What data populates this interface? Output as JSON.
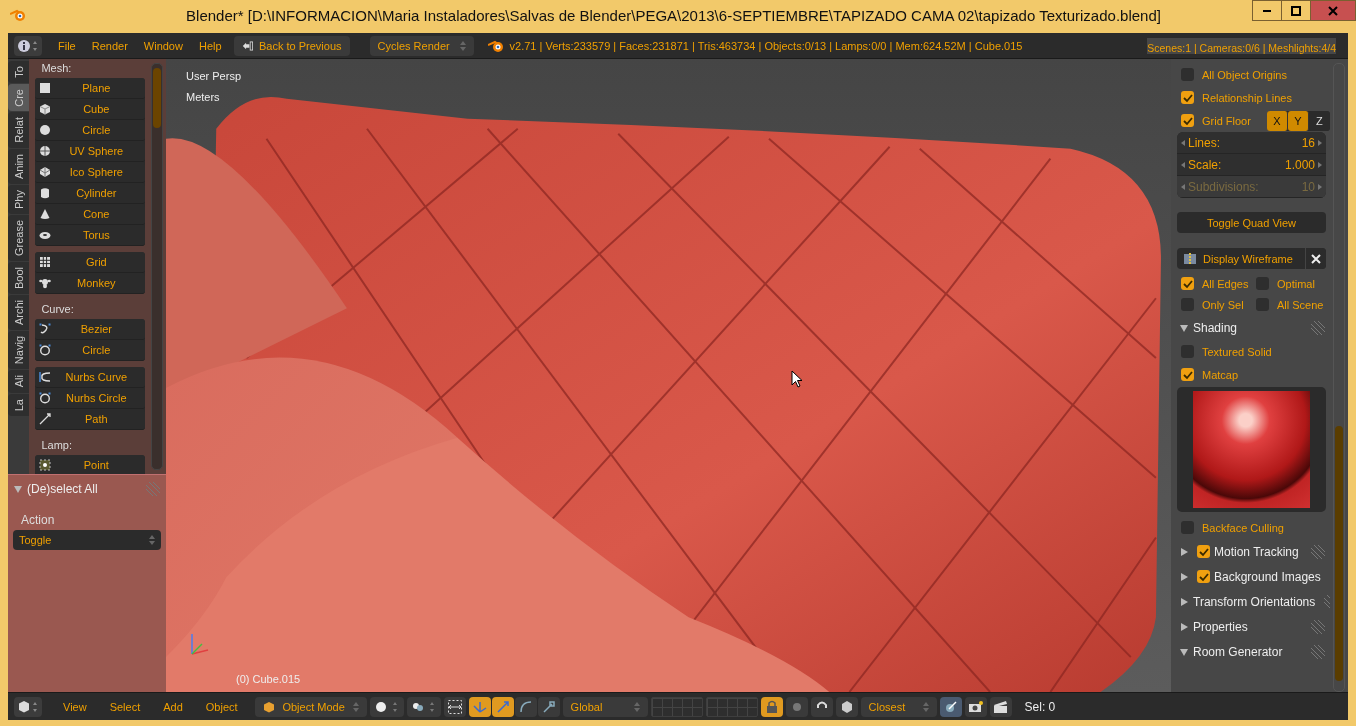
{
  "title_bar": {
    "title": "Blender* [D:\\INFORMACION\\Maria Instaladores\\Salvas de Blender\\PEGA\\2013\\6-SEPTIEMBRE\\TAPIZADO CAMA 02\\tapizado Texturizado.blend]"
  },
  "header": {
    "menus": [
      "File",
      "Render",
      "Window",
      "Help"
    ],
    "back_button": "Back to Previous",
    "render_engine": "Cycles Render",
    "stats": "v2.71 | Verts:233579 | Faces:231871 | Tris:463734 | Objects:0/13 | Lamps:0/0 | Mem:624.52M | Cube.015",
    "stats_right": "Scenes:1 | Cameras:0/6 | Meshlights:4/4"
  },
  "tool_tabs": [
    {
      "label": "To",
      "selected": false
    },
    {
      "label": "Cre",
      "selected": true
    },
    {
      "label": "Relat",
      "selected": false
    },
    {
      "label": "Anim",
      "selected": false
    },
    {
      "label": "Phy",
      "selected": false
    },
    {
      "label": "Grease",
      "selected": false
    },
    {
      "label": "Bool",
      "selected": false
    },
    {
      "label": "Archi",
      "selected": false
    },
    {
      "label": "Navig",
      "selected": false
    },
    {
      "label": "Ali",
      "selected": false
    },
    {
      "label": "La",
      "selected": false
    }
  ],
  "tool_sections": [
    {
      "heading": "Mesh:",
      "groups": [
        [
          {
            "label": "Plane",
            "kind": "plane"
          },
          {
            "label": "Cube",
            "kind": "cube"
          },
          {
            "label": "Circle",
            "kind": "circle"
          },
          {
            "label": "UV Sphere",
            "kind": "uvsphere"
          },
          {
            "label": "Ico Sphere",
            "kind": "icosphere"
          },
          {
            "label": "Cylinder",
            "kind": "cylinder"
          },
          {
            "label": "Cone",
            "kind": "cone"
          },
          {
            "label": "Torus",
            "kind": "torus"
          }
        ],
        [
          {
            "label": "Grid",
            "kind": "grid"
          },
          {
            "label": "Monkey",
            "kind": "monkey"
          }
        ]
      ]
    },
    {
      "heading": "Curve:",
      "groups": [
        [
          {
            "label": "Bezier",
            "kind": "bezier"
          },
          {
            "label": "Circle",
            "kind": "curvecircle"
          }
        ],
        [
          {
            "label": "Nurbs Curve",
            "kind": "nurbscurve"
          },
          {
            "label": "Nurbs Circle",
            "kind": "curvecircle"
          },
          {
            "label": "Path",
            "kind": "path"
          }
        ]
      ]
    },
    {
      "heading": "Lamp:",
      "groups": [
        [
          {
            "label": "Point",
            "kind": "point"
          }
        ]
      ]
    }
  ],
  "operator_panel": {
    "title": "(De)select All",
    "expanded": true,
    "field_label": "Action",
    "value": "Toggle"
  },
  "viewport": {
    "view": "User Persp",
    "units": "Meters",
    "object": "(0) Cube.015"
  },
  "properties": [
    {
      "kind": "checkbox",
      "label": "All Object Origins",
      "checked": false
    },
    {
      "kind": "checkbox",
      "label": "Relationship Lines",
      "checked": true
    },
    {
      "kind": "grid_floor",
      "label": "Grid Floor",
      "checked": true,
      "axes": [
        {
          "label": "X",
          "selected": true
        },
        {
          "label": "Y",
          "selected": true
        },
        {
          "label": "Z",
          "selected": false
        }
      ]
    },
    {
      "kind": "numbers",
      "fields": [
        {
          "label": "Lines:",
          "value": "16",
          "disabled": false
        },
        {
          "label": "Scale:",
          "value": "1.000",
          "disabled": false
        },
        {
          "label": "Subdivisions:",
          "value": "10",
          "disabled": true
        }
      ]
    },
    {
      "kind": "button",
      "label": "Toggle Quad View"
    },
    {
      "kind": "addon",
      "label": "Display Wireframe"
    },
    {
      "kind": "checkbox_grid",
      "items": [
        {
          "label": "All Edges",
          "checked": true
        },
        {
          "label": "Optimal",
          "checked": false
        },
        {
          "label": "Only Sel",
          "checked": false
        },
        {
          "label": "All Scene",
          "checked": false
        }
      ]
    },
    {
      "kind": "panel",
      "label": "Shading",
      "expanded": true
    },
    {
      "kind": "checkbox",
      "label": "Textured Solid",
      "checked": false
    },
    {
      "kind": "checkbox",
      "label": "Matcap",
      "checked": true
    },
    {
      "kind": "matcap"
    },
    {
      "kind": "checkbox",
      "label": "Backface Culling",
      "checked": false
    },
    {
      "kind": "panel_check",
      "label": "Motion Tracking",
      "expanded": false,
      "checked": true
    },
    {
      "kind": "panel_check",
      "label": "Background Images",
      "expanded": false,
      "checked": true
    },
    {
      "kind": "panel",
      "label": "Transform Orientations",
      "expanded": false
    },
    {
      "kind": "panel",
      "label": "Properties",
      "expanded": false
    },
    {
      "kind": "panel",
      "label": "Room Generator",
      "expanded": true
    }
  ],
  "footer": {
    "menus": [
      "View",
      "Select",
      "Add",
      "Object"
    ],
    "mode": "Object Mode",
    "manipulators": [
      {
        "selected": true
      },
      {
        "selected": true
      },
      {
        "selected": false
      },
      {
        "selected": false
      }
    ],
    "orientation": "Global",
    "lock_camera": true,
    "snap_target": "Closest",
    "status": "Sel: 0"
  }
}
